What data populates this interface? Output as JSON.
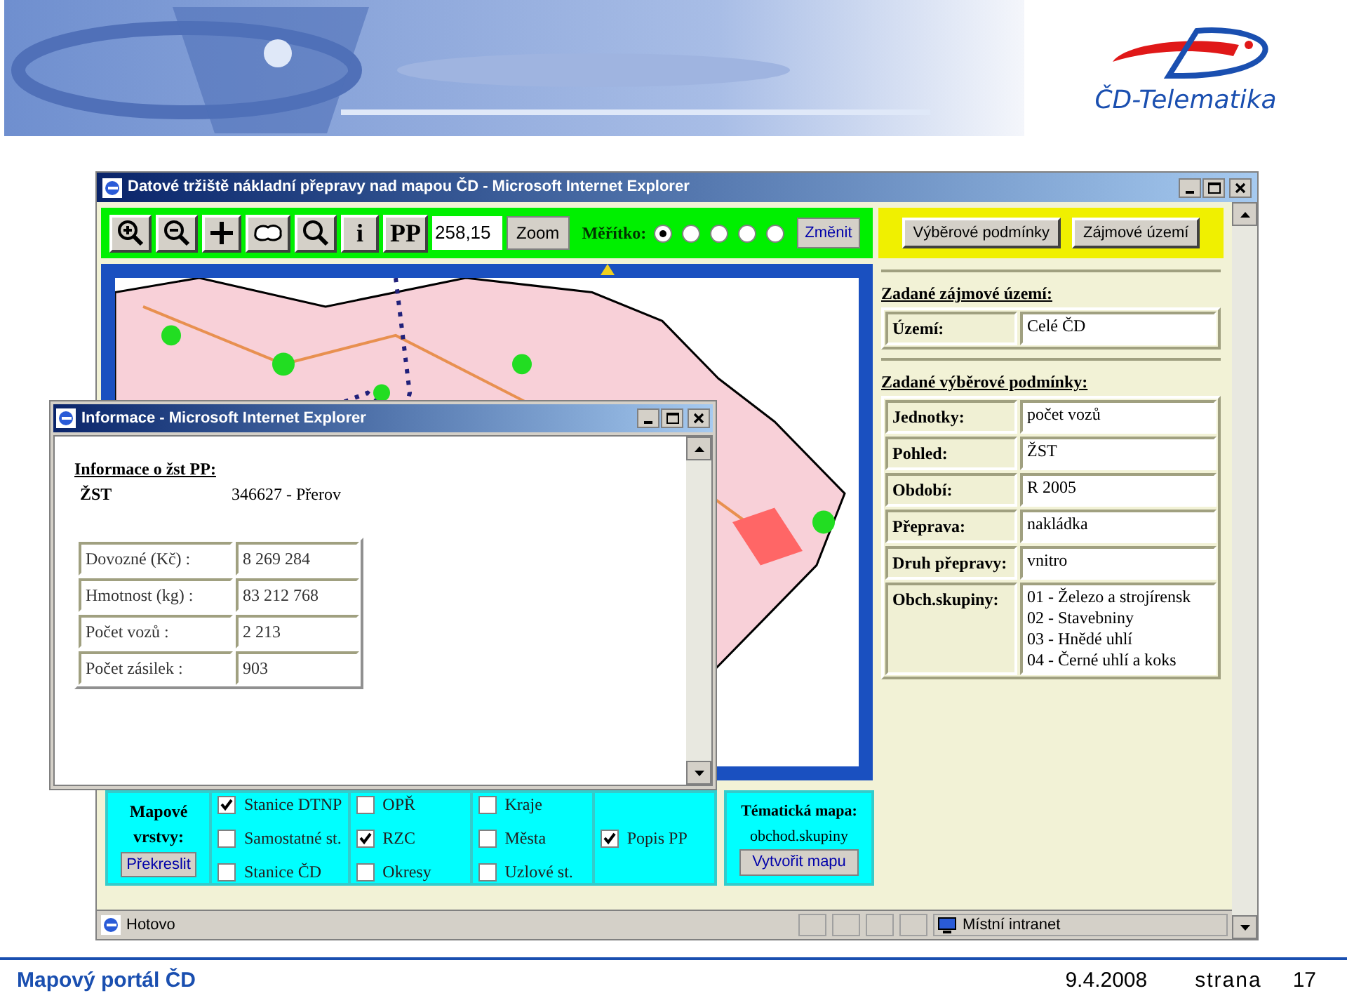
{
  "banner": {
    "logo_text": "ČD-Telematika"
  },
  "browser": {
    "title": "Datové tržiště nákladní přepravy nad mapou ČD - Microsoft Internet Explorer",
    "toolbar": {
      "text_tools": [
        "i",
        "PP"
      ],
      "zoom_value": "258,15",
      "zoom_button": "Zoom",
      "scale_label": "Měřítko:",
      "scale_options": [
        {
          "selected": true
        },
        {
          "selected": false
        },
        {
          "selected": false
        },
        {
          "selected": false
        },
        {
          "selected": false
        }
      ],
      "change_button": "Změnit"
    },
    "side_buttons": [
      "Výběrové podmínky",
      "Zájmové území"
    ],
    "sections": [
      {
        "heading": "Zadané zájmové území:",
        "rows": [
          {
            "label": "Území:",
            "lines": [
              "Celé ČD"
            ]
          }
        ]
      },
      {
        "heading": "Zadané výběrové podmínky:",
        "rows": [
          {
            "label": "Jednotky:",
            "lines": [
              "počet vozů"
            ]
          },
          {
            "label": "Pohled:",
            "lines": [
              "ŽST"
            ]
          },
          {
            "label": "Období:",
            "lines": [
              "R 2005"
            ]
          },
          {
            "label": "Přeprava:",
            "lines": [
              "nakládka"
            ]
          },
          {
            "label": "Druh přepravy:",
            "lines": [
              "vnitro"
            ]
          },
          {
            "label": "Obch.skupiny:",
            "lines": [
              "01 - Železo a strojírensk",
              "02 - Stavebniny",
              "03 - Hnědé uhlí",
              "04 - Černé uhlí a koks"
            ]
          }
        ]
      }
    ],
    "layers": {
      "title": "Mapové vrstvy:",
      "redraw_button": "Překreslit",
      "columns": [
        [
          {
            "label": "Stanice DTNP",
            "checked": true
          },
          {
            "label": "Samostatné st.",
            "checked": false
          },
          {
            "label": "Stanice ČD",
            "checked": false
          }
        ],
        [
          {
            "label": "OPŘ",
            "checked": false
          },
          {
            "label": "RZC",
            "checked": true
          },
          {
            "label": "Okresy",
            "checked": false
          }
        ],
        [
          {
            "label": "Kraje",
            "checked": false
          },
          {
            "label": "Města",
            "checked": false
          },
          {
            "label": "Uzlové st.",
            "checked": false
          }
        ],
        [
          {
            "label": "Popis PP",
            "checked": true
          }
        ]
      ]
    },
    "thematic": {
      "title": "Tématická mapa:",
      "value": "obchod.skupiny",
      "button": "Vytvořit mapu"
    },
    "status": {
      "text": "Hotovo",
      "zone": "Místní intranet"
    }
  },
  "popup": {
    "title": "Informace - Microsoft Internet Explorer",
    "heading": "Informace o žst PP:",
    "station_label": "ŽST",
    "station_value": "346627 - Přerov",
    "rows": [
      {
        "label": "Dovozné (Kč) :",
        "value": "8 269 284"
      },
      {
        "label": "Hmotnost (kg) :",
        "value": "83 212 768"
      },
      {
        "label": "Počet vozů :",
        "value": "2 213"
      },
      {
        "label": "Počet zásilek :",
        "value": "903"
      }
    ]
  },
  "footer": {
    "title": "Mapový portál ČD",
    "date": "9.4.2008",
    "page_label": "strana",
    "page": "17"
  }
}
